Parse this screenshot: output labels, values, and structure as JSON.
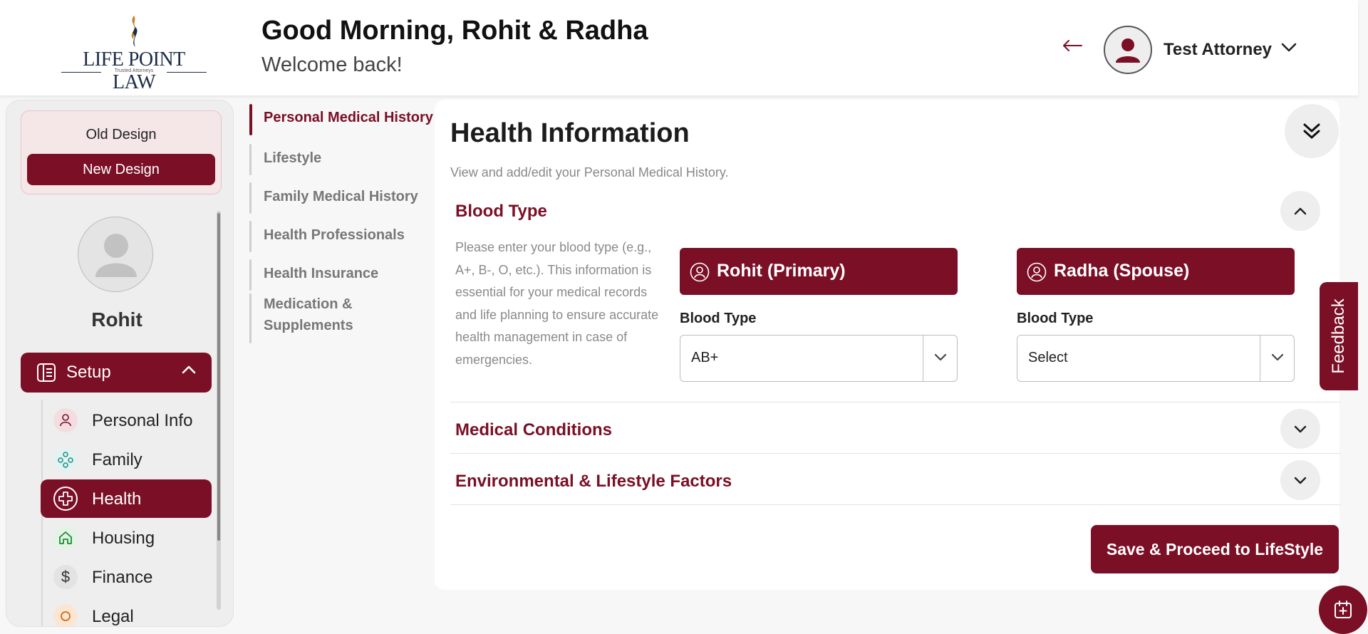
{
  "header": {
    "logo_title": "LIFE POINT LAW",
    "logo_tagline": "Trusted Attorneys",
    "greeting": "Good Morning, Rohit & Radha",
    "welcome": "Welcome back!",
    "user_name": "Test Attorney"
  },
  "sidebar": {
    "old_design_label": "Old Design",
    "new_design_label": "New Design",
    "profile_name": "Rohit",
    "setup_label": "Setup",
    "items": [
      {
        "label": "Personal Info",
        "icon": "person-icon"
      },
      {
        "label": "Family",
        "icon": "family-icon"
      },
      {
        "label": "Health",
        "icon": "health-cross-icon",
        "active": true
      },
      {
        "label": "Housing",
        "icon": "house-icon"
      },
      {
        "label": "Finance",
        "icon": "dollar-icon"
      },
      {
        "label": "Legal",
        "icon": "legal-icon"
      }
    ]
  },
  "steps": [
    {
      "label": "Personal Medical History",
      "active": true
    },
    {
      "label": "Lifestyle"
    },
    {
      "label": "Family Medical History"
    },
    {
      "label": "Health Professionals"
    },
    {
      "label": "Health Insurance"
    },
    {
      "label": "Medication & Supplements"
    }
  ],
  "main": {
    "title": "Health Information",
    "subtitle": "View and add/edit your Personal Medical History.",
    "sections": [
      {
        "title": "Blood Type",
        "expanded": true
      },
      {
        "title": "Medical Conditions",
        "expanded": false
      },
      {
        "title": "Environmental & Lifestyle Factors",
        "expanded": false
      }
    ],
    "blood_type_description": "Please enter your blood type (e.g., A+, B-, O, etc.). This information is essential for your medical records and life planning to ensure accurate health management in case of emergencies.",
    "people": [
      {
        "name": "Rohit (Primary)",
        "field_label": "Blood Type",
        "value": "AB+"
      },
      {
        "name": "Radha (Spouse)",
        "field_label": "Blood Type",
        "value": "Select"
      }
    ],
    "save_button": "Save & Proceed to LifeStyle"
  },
  "feedback_label": "Feedback",
  "colors": {
    "brand": "#7a0f26",
    "brand_light": "#f5e6e8",
    "background": "#f7f7f7"
  }
}
